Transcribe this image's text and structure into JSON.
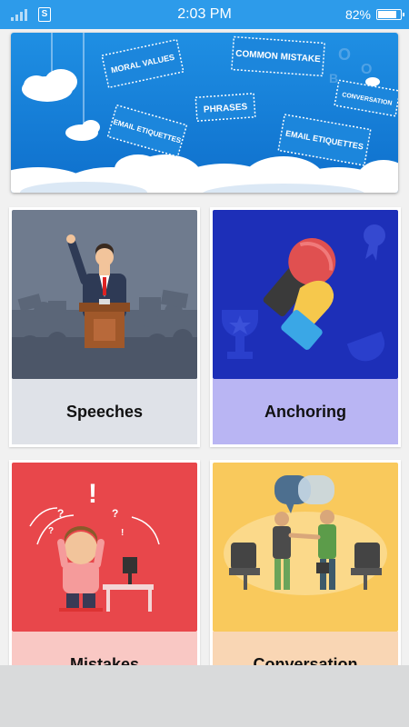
{
  "status_bar": {
    "time": "2:03 PM",
    "battery_percent": "82%",
    "battery_level": 0.82,
    "icons": [
      "signal-icon",
      "sim-icon",
      "battery-icon"
    ]
  },
  "banner": {
    "tags": [
      "MORAL VALUES",
      "COMMON MISTAKE",
      "CONVERSATION",
      "PHRASES",
      "EMAIL ETIQUETTES",
      "EMAIL ETIQUETTES"
    ]
  },
  "categories": [
    {
      "label": "Speeches",
      "label_bg": "#dfe2e8",
      "image": "speech-podium-illustration"
    },
    {
      "label": "Anchoring",
      "label_bg": "#b9b5f3",
      "image": "microphone-trophy-illustration"
    },
    {
      "label": "Mistakes",
      "label_bg": "#f9c8c4",
      "image": "confused-man-illustration"
    },
    {
      "label": "Conversation",
      "label_bg": "#f9d6b4",
      "image": "handshake-illustration"
    }
  ]
}
